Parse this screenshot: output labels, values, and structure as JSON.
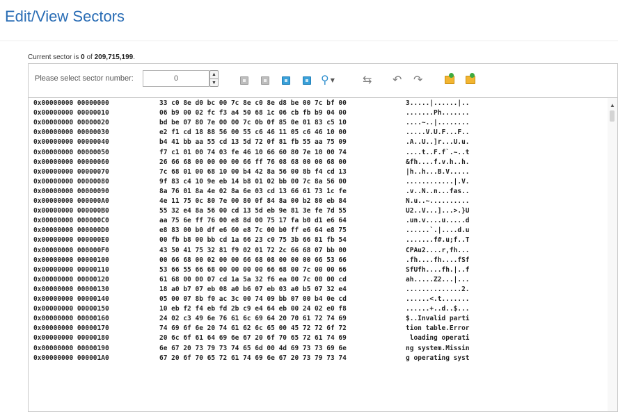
{
  "page": {
    "title": "Edit/View Sectors"
  },
  "status": {
    "current_prefix": "Current sector is ",
    "current_value": "0",
    "current_mid": " of ",
    "total_sectors": "209,715,199",
    "current_suffix": "."
  },
  "toolbar": {
    "sector_label": "Please select sector number:",
    "sector_value": "0",
    "icons": [
      "first-sector-icon",
      "previous-sector-icon",
      "next-sector-icon",
      "last-sector-icon",
      "search-icon",
      "jump-icon",
      "undo-icon",
      "redo-icon",
      "import-folder-icon",
      "export-folder-icon"
    ]
  },
  "rows": [
    {
      "addr": "0x00000000 00000000",
      "hex": "33 c0 8e d0 bc 00 7c 8e c0 8e d8 be 00 7c bf 00",
      "ascii": "3.....|......|.."
    },
    {
      "addr": "0x00000000 00000010",
      "hex": "06 b9 00 02 fc f3 a4 50 68 1c 06 cb fb b9 04 00",
      "ascii": ".......Ph......."
    },
    {
      "addr": "0x00000000 00000020",
      "hex": "bd be 07 80 7e 00 00 7c 0b 0f 85 0e 01 83 c5 10",
      "ascii": "....~..|........"
    },
    {
      "addr": "0x00000000 00000030",
      "hex": "e2 f1 cd 18 88 56 00 55 c6 46 11 05 c6 46 10 00",
      "ascii": ".....V.U.F...F.."
    },
    {
      "addr": "0x00000000 00000040",
      "hex": "b4 41 bb aa 55 cd 13 5d 72 0f 81 fb 55 aa 75 09",
      "ascii": ".A..U..]r...U.u."
    },
    {
      "addr": "0x00000000 00000050",
      "hex": "f7 c1 01 00 74 03 fe 46 10 66 60 80 7e 10 00 74",
      "ascii": "....t..F.f`.~..t"
    },
    {
      "addr": "0x00000000 00000060",
      "hex": "26 66 68 00 00 00 00 66 ff 76 08 68 00 00 68 00",
      "ascii": "&fh....f.v.h..h."
    },
    {
      "addr": "0x00000000 00000070",
      "hex": "7c 68 01 00 68 10 00 b4 42 8a 56 00 8b f4 cd 13",
      "ascii": "|h..h...B.V....."
    },
    {
      "addr": "0x00000000 00000080",
      "hex": "9f 83 c4 10 9e eb 14 b8 01 02 bb 00 7c 8a 56 00",
      "ascii": "............|.V."
    },
    {
      "addr": "0x00000000 00000090",
      "hex": "8a 76 01 8a 4e 02 8a 6e 03 cd 13 66 61 73 1c fe",
      "ascii": ".v..N..n...fas.."
    },
    {
      "addr": "0x00000000 000000A0",
      "hex": "4e 11 75 0c 80 7e 00 80 0f 84 8a 00 b2 80 eb 84",
      "ascii": "N.u..~.........."
    },
    {
      "addr": "0x00000000 000000B0",
      "hex": "55 32 e4 8a 56 00 cd 13 5d eb 9e 81 3e fe 7d 55",
      "ascii": "U2..V...]...>.}U"
    },
    {
      "addr": "0x00000000 000000C0",
      "hex": "aa 75 6e ff 76 00 e8 8d 00 75 17 fa b0 d1 e6 64",
      "ascii": ".un.v....u.....d"
    },
    {
      "addr": "0x00000000 000000D0",
      "hex": "e8 83 00 b0 df e6 60 e8 7c 00 b0 ff e6 64 e8 75",
      "ascii": "......`.|....d.u"
    },
    {
      "addr": "0x00000000 000000E0",
      "hex": "00 fb b8 00 bb cd 1a 66 23 c0 75 3b 66 81 fb 54",
      "ascii": ".......f#.u;f..T"
    },
    {
      "addr": "0x00000000 000000F0",
      "hex": "43 50 41 75 32 81 f9 02 01 72 2c 66 68 07 bb 00",
      "ascii": "CPAu2....r,fh..."
    },
    {
      "addr": "0x00000000 00000100",
      "hex": "00 66 68 00 02 00 00 66 68 08 00 00 00 66 53 66",
      "ascii": ".fh....fh....fSf"
    },
    {
      "addr": "0x00000000 00000110",
      "hex": "53 66 55 66 68 00 00 00 00 66 68 00 7c 00 00 66",
      "ascii": "SfUfh....fh.|..f"
    },
    {
      "addr": "0x00000000 00000120",
      "hex": "61 68 00 00 07 cd 1a 5a 32 f6 ea 00 7c 00 00 cd",
      "ascii": "ah.....Z2...|..."
    },
    {
      "addr": "0x00000000 00000130",
      "hex": "18 a0 b7 07 eb 08 a0 b6 07 eb 03 a0 b5 07 32 e4",
      "ascii": "..............2."
    },
    {
      "addr": "0x00000000 00000140",
      "hex": "05 00 07 8b f0 ac 3c 00 74 09 bb 07 00 b4 0e cd",
      "ascii": "......<.t......."
    },
    {
      "addr": "0x00000000 00000150",
      "hex": "10 eb f2 f4 eb fd 2b c9 e4 64 eb 00 24 02 e0 f8",
      "ascii": "......+..d..$..."
    },
    {
      "addr": "0x00000000 00000160",
      "hex": "24 02 c3 49 6e 76 61 6c 69 64 20 70 61 72 74 69",
      "ascii": "$..Invalid parti"
    },
    {
      "addr": "0x00000000 00000170",
      "hex": "74 69 6f 6e 20 74 61 62 6c 65 00 45 72 72 6f 72",
      "ascii": "tion table.Error"
    },
    {
      "addr": "0x00000000 00000180",
      "hex": "20 6c 6f 61 64 69 6e 67 20 6f 70 65 72 61 74 69",
      "ascii": " loading operati"
    },
    {
      "addr": "0x00000000 00000190",
      "hex": "6e 67 20 73 79 73 74 65 6d 00 4d 69 73 73 69 6e",
      "ascii": "ng system.Missin"
    },
    {
      "addr": "0x00000000 000001A0",
      "hex": "67 20 6f 70 65 72 61 74 69 6e 67 20 73 79 73 74",
      "ascii": "g operating syst"
    }
  ]
}
